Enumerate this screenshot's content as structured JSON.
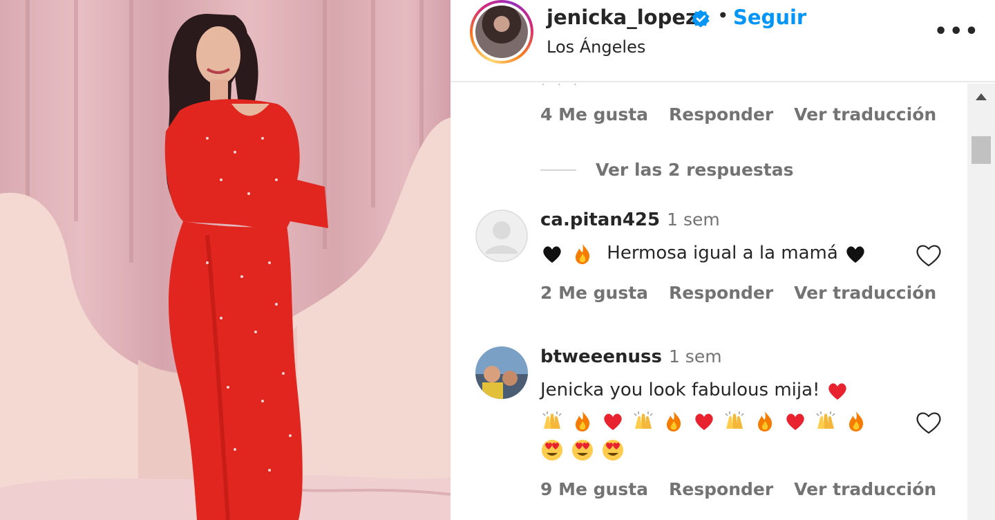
{
  "post": {
    "username": "jenicka_lopez",
    "separator": "•",
    "follow_label": "Seguir",
    "location": "Los Ángeles",
    "more_label": "•••"
  },
  "comments": {
    "first_actions": {
      "likes": "4 Me gusta",
      "reply": "Responder",
      "translate": "Ver traducción"
    },
    "view_replies": "Ver las 2 respuestas",
    "items": [
      {
        "username": "ca.pitan425",
        "time": "1 sem",
        "text": "Hermosa igual a la mamá",
        "likes": "2 Me gusta",
        "reply": "Responder",
        "translate": "Ver traducción",
        "emojis_before": [
          "black-heart",
          "fire"
        ],
        "emojis_after": [
          "black-heart"
        ]
      },
      {
        "username": "btweeenuss",
        "time": "1 sem",
        "text": "Jenicka you look fabulous mija!",
        "likes": "9 Me gusta",
        "reply": "Responder",
        "translate": "Ver traducción",
        "emojis_after": [
          "red-heart"
        ],
        "emoji_row_1": [
          "raising-hands",
          "fire",
          "red-heart",
          "raising-hands",
          "fire",
          "red-heart",
          "raising-hands",
          "fire",
          "red-heart",
          "raising-hands",
          "fire"
        ],
        "emoji_row_2": [
          "heart-eyes",
          "heart-eyes",
          "heart-eyes"
        ]
      }
    ]
  },
  "colors": {
    "follow": "#0095f6",
    "verified": "#0095f6",
    "dress": "#e0261f",
    "muted": "#737373"
  }
}
